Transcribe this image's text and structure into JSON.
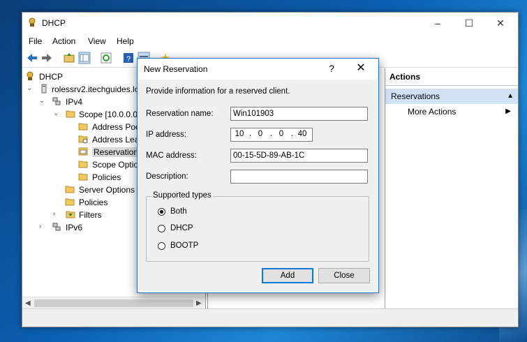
{
  "window": {
    "title": "DHCP"
  },
  "menu": [
    "File",
    "Action",
    "View",
    "Help"
  ],
  "tree": {
    "root": "DHCP",
    "server": "rolessrv2.itechguides.lo",
    "ipv4": "IPv4",
    "scope": "Scope [10.0.0.0]",
    "address_pool": "Address Poo",
    "address_leases": "Address Leas",
    "reservations": "Reservations",
    "scope_options": "Scope Optio",
    "scope_policies": "Policies",
    "server_options": "Server Options",
    "policies": "Policies",
    "filters": "Filters",
    "ipv6": "IPv6"
  },
  "actions": {
    "header": "Actions",
    "group": "Reservations",
    "more": "More Actions"
  },
  "dialog": {
    "title": "New Reservation",
    "help_glyph": "?",
    "close_glyph": "✕",
    "intro": "Provide information for a reserved client.",
    "reservation_name_label": "Reservation name:",
    "reservation_name_value": "Win101903",
    "ip_label": "IP address:",
    "ip_octets": [
      "10",
      "0",
      "0",
      "40"
    ],
    "mac_label": "MAC address:",
    "mac_value": "00-15-5D-89-AB-1C",
    "description_label": "Description:",
    "description_value": "",
    "supported_types_label": "Supported types",
    "types": [
      {
        "label": "Both",
        "checked": true
      },
      {
        "label": "DHCP",
        "checked": false
      },
      {
        "label": "BOOTP",
        "checked": false
      }
    ],
    "add_label": "Add",
    "close_label": "Close"
  }
}
